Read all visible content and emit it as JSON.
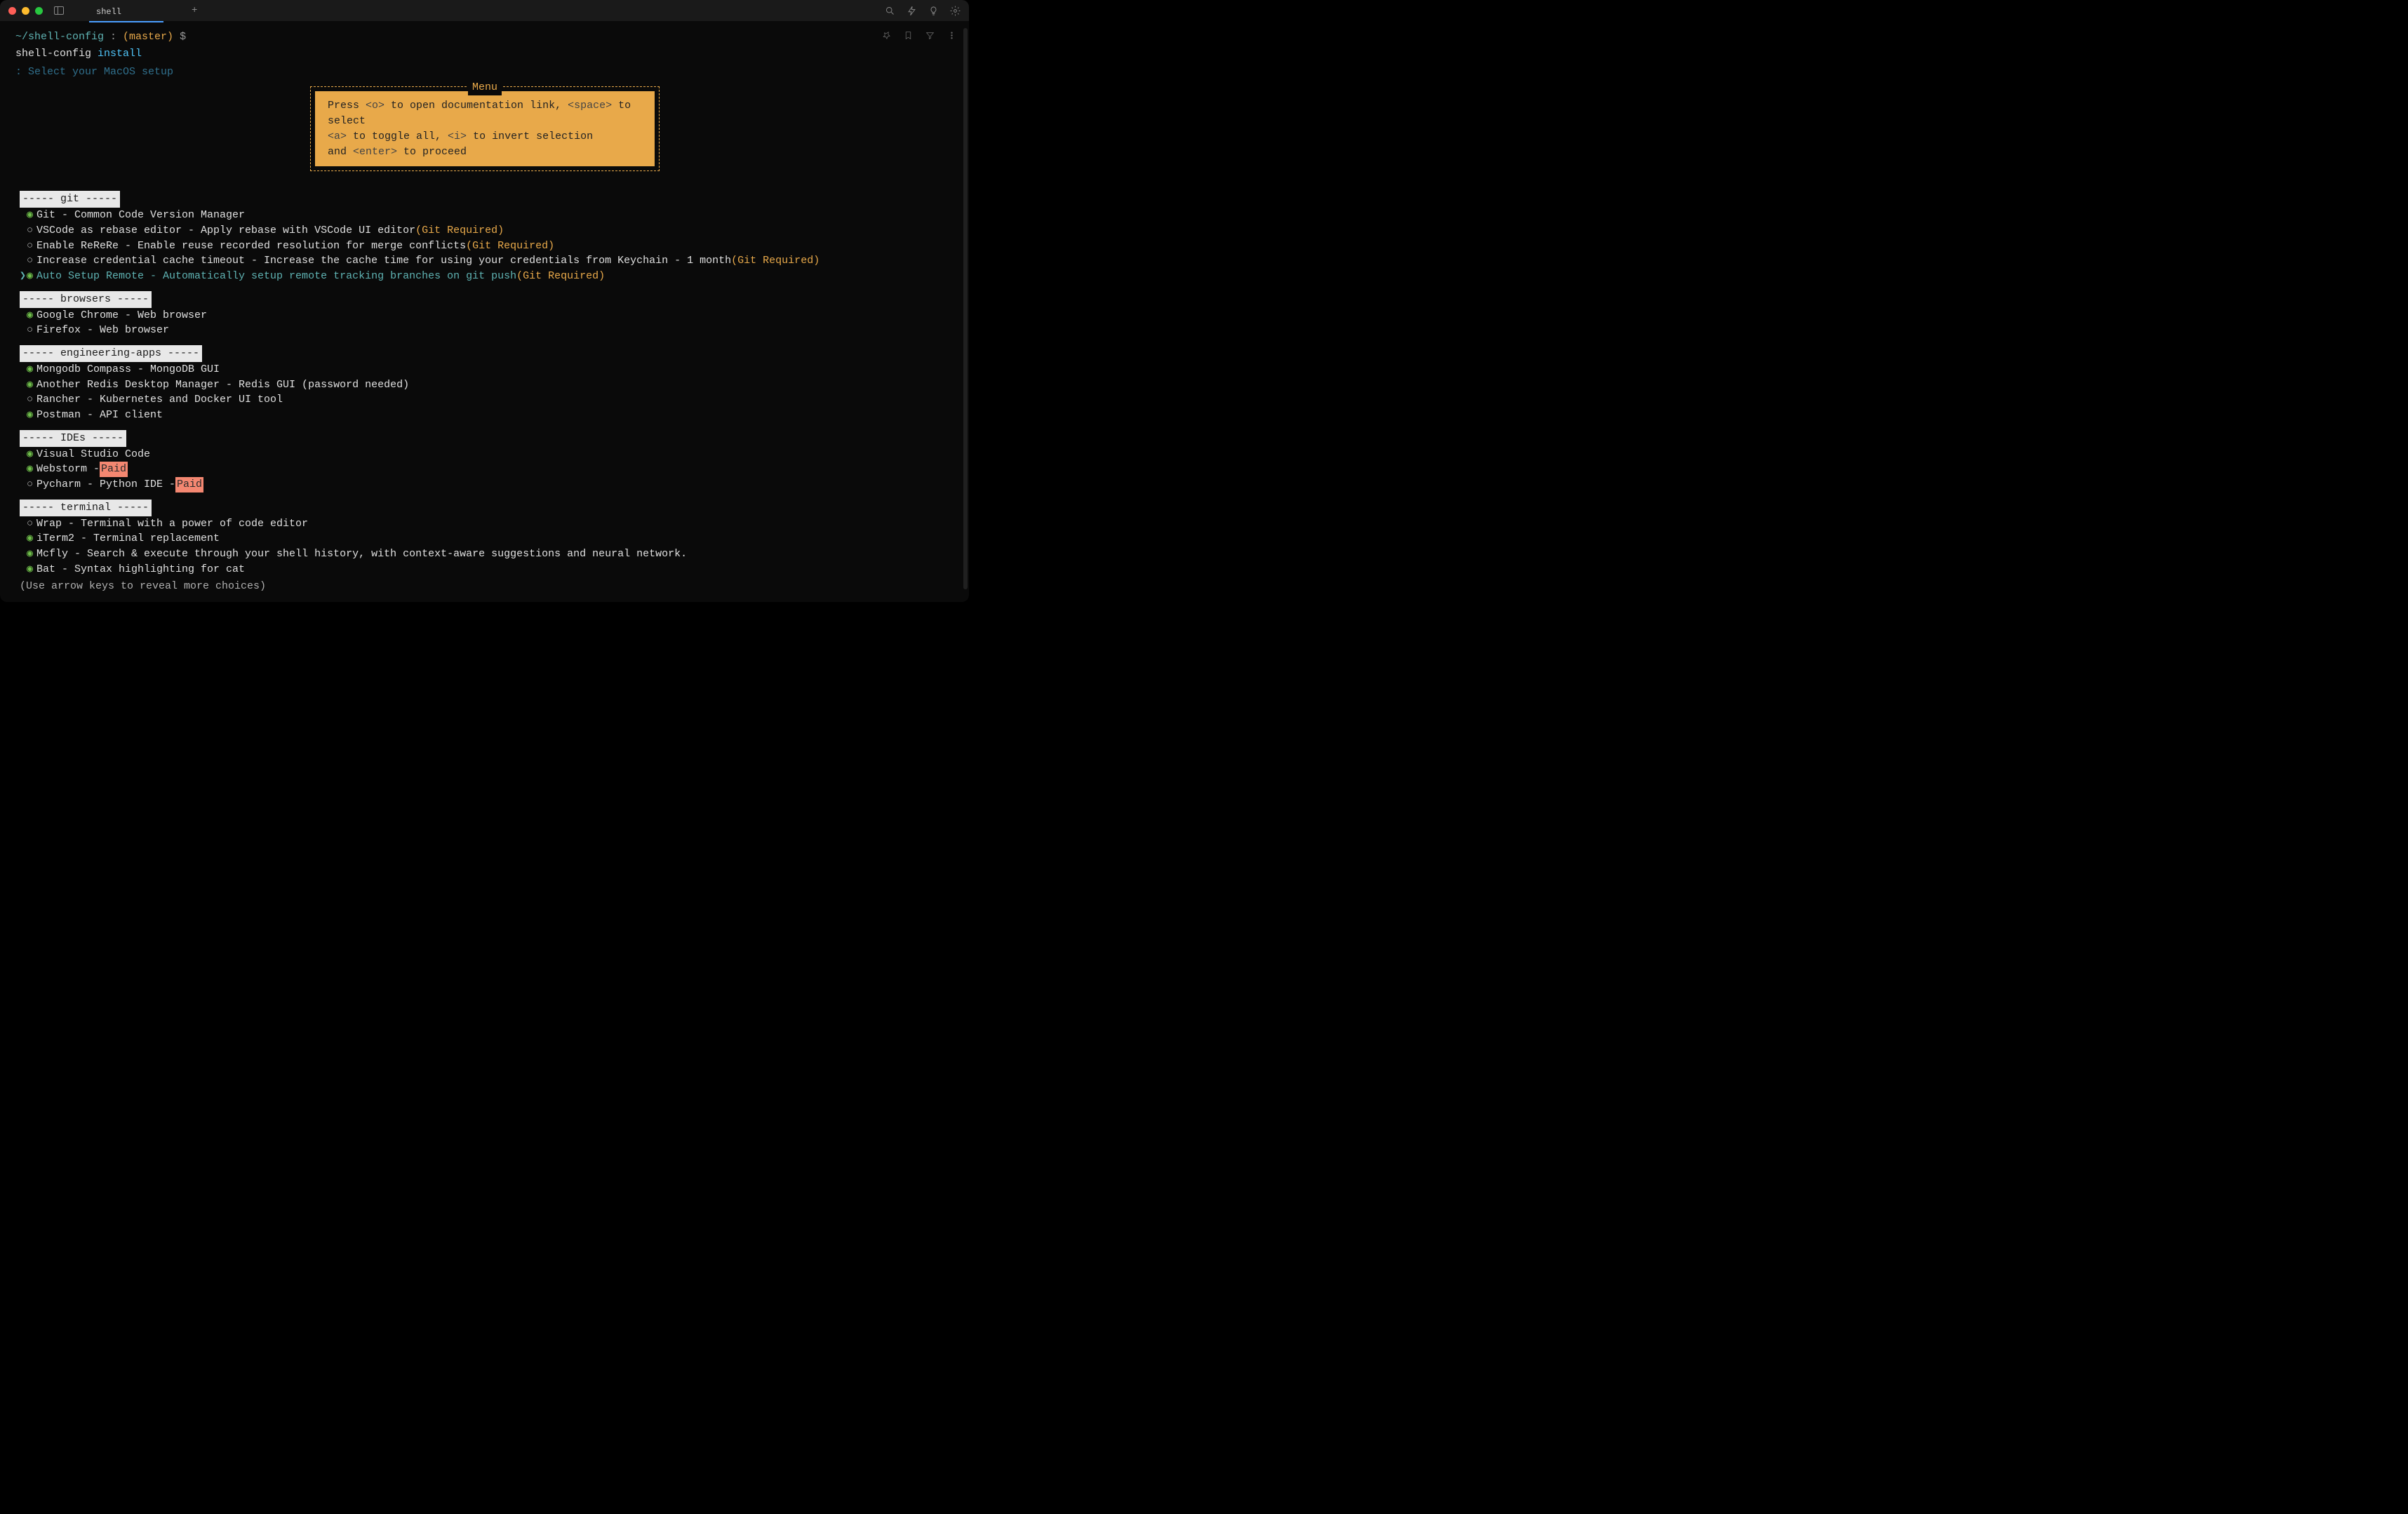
{
  "window": {
    "tab_title": "shell",
    "new_tab_glyph": "+"
  },
  "prompt": {
    "path": "~/shell-config",
    "separator": " : ",
    "branch": "(master)",
    "dollar": " $ "
  },
  "command": {
    "exe": "shell-config",
    "arg": " install"
  },
  "truncated_line": ": Select your MacOS setup",
  "menu": {
    "title": "Menu",
    "line1_a": "Press ",
    "line1_k1": "<o>",
    "line1_b": " to open documentation link, ",
    "line1_k2": "<space>",
    "line1_c": " to select",
    "line2_k1": "<a>",
    "line2_a": " to toggle all, ",
    "line2_k2": "<i>",
    "line2_b": " to invert selection",
    "line3_a": "and ",
    "line3_k1": "<enter>",
    "line3_b": " to proceed"
  },
  "sections": [
    {
      "header": " ----- git ----- ",
      "items": [
        {
          "selected": true,
          "cursor": false,
          "text": "Git - Common Code Version Manager",
          "suffix": ""
        },
        {
          "selected": false,
          "cursor": false,
          "text": "VSCode as rebase editor - Apply rebase with VSCode UI editor ",
          "suffix": "(Git Required)"
        },
        {
          "selected": false,
          "cursor": false,
          "text": "Enable ReReRe - Enable reuse recorded resolution for merge conflicts ",
          "suffix": "(Git Required)"
        },
        {
          "selected": false,
          "cursor": false,
          "text": "Increase credential cache timeout - Increase the cache time for using your credentials from Keychain - 1 month ",
          "suffix": "(Git Required)"
        },
        {
          "selected": true,
          "cursor": true,
          "text": "Auto Setup Remote - Automatically setup remote tracking branches on git push ",
          "suffix": "(Git Required)",
          "highlight": true
        }
      ]
    },
    {
      "header": " ----- browsers ----- ",
      "items": [
        {
          "selected": true,
          "cursor": false,
          "text": "Google Chrome - Web browser",
          "suffix": ""
        },
        {
          "selected": false,
          "cursor": false,
          "text": "Firefox - Web browser",
          "suffix": ""
        }
      ]
    },
    {
      "header": " ----- engineering-apps ----- ",
      "items": [
        {
          "selected": true,
          "cursor": false,
          "text": "Mongodb Compass - MongoDB GUI",
          "suffix": ""
        },
        {
          "selected": true,
          "cursor": false,
          "text": "Another Redis Desktop Manager - Redis GUI (password needed)",
          "suffix": ""
        },
        {
          "selected": false,
          "cursor": false,
          "text": "Rancher - Kubernetes and Docker UI tool",
          "suffix": ""
        },
        {
          "selected": true,
          "cursor": false,
          "text": "Postman - API client",
          "suffix": ""
        }
      ]
    },
    {
      "header": " ----- IDEs ----- ",
      "items": [
        {
          "selected": true,
          "cursor": false,
          "text": "Visual Studio Code",
          "suffix": ""
        },
        {
          "selected": true,
          "cursor": false,
          "text": "Webstorm - ",
          "paid": "Paid"
        },
        {
          "selected": false,
          "cursor": false,
          "text": "Pycharm - Python IDE - ",
          "paid": "Paid"
        }
      ]
    },
    {
      "header": " ----- terminal ----- ",
      "items": [
        {
          "selected": false,
          "cursor": false,
          "text": "Wrap - Terminal with a power of code editor",
          "suffix": ""
        },
        {
          "selected": true,
          "cursor": false,
          "text": "iTerm2 - Terminal replacement",
          "suffix": ""
        },
        {
          "selected": true,
          "cursor": false,
          "text": "Mcfly - Search & execute through your shell history, with context-aware suggestions and neural network.",
          "suffix": ""
        },
        {
          "selected": true,
          "cursor": false,
          "text": "Bat - Syntax highlighting for cat",
          "suffix": ""
        }
      ]
    }
  ],
  "footer_hint": "(Use arrow keys to reveal more choices)"
}
